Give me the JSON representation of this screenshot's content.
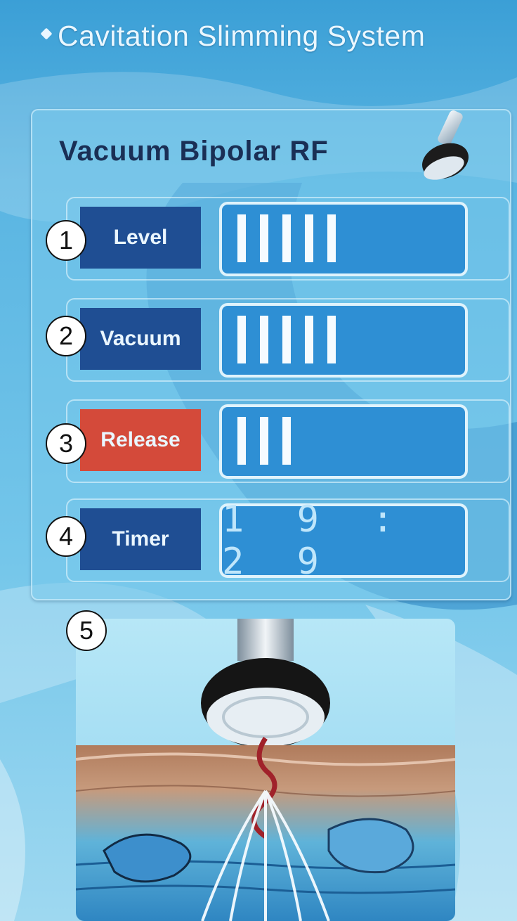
{
  "header": {
    "title": "Cavitation Slimming System"
  },
  "panel": {
    "title": "Vacuum Bipolar RF",
    "rows": [
      {
        "number": "1",
        "label": "Level",
        "active": false,
        "level": 5
      },
      {
        "number": "2",
        "label": "Vacuum",
        "active": false,
        "level": 5
      },
      {
        "number": "3",
        "label": "Release",
        "active": true,
        "level": 3
      },
      {
        "number": "4",
        "label": "Timer",
        "active": false,
        "value": "19:29",
        "display": "1 9 : 2 9"
      }
    ]
  },
  "illustration": {
    "number": "5"
  },
  "colors": {
    "accent": "#1f4e93",
    "active": "#d44a3a",
    "bar_bg": "#2e8fd4",
    "bar_seg": "#f5fbff"
  }
}
